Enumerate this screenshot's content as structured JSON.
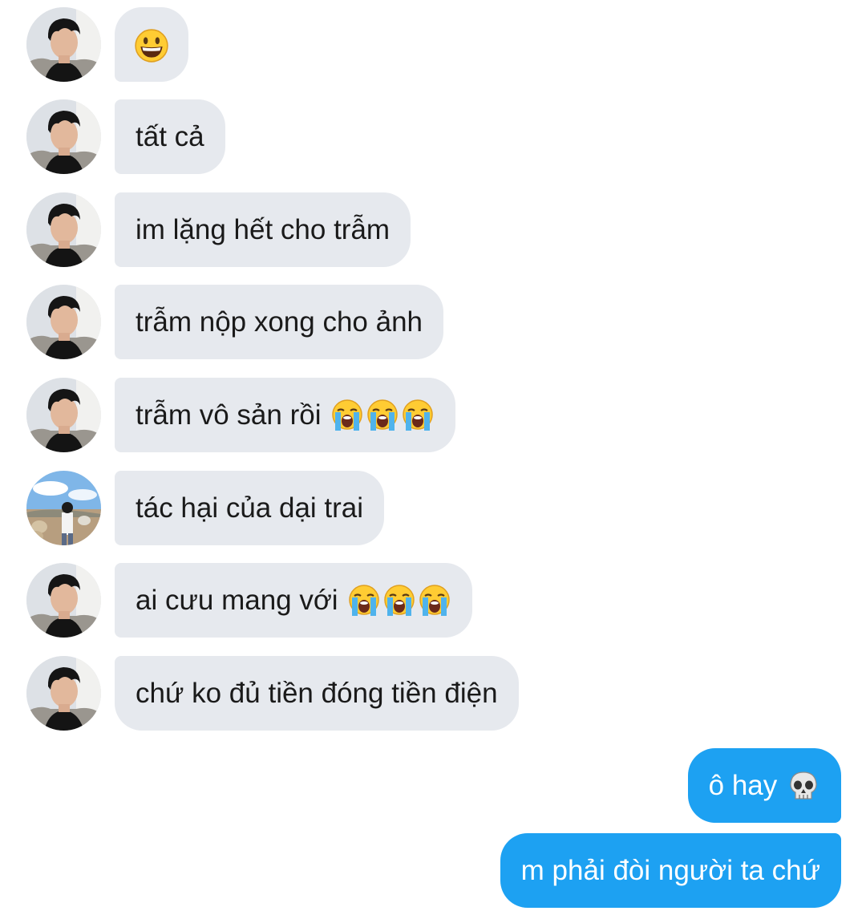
{
  "messages": [
    {
      "text": "",
      "emoji": [
        "grinning-face"
      ]
    },
    {
      "text": "tất cả",
      "emoji": []
    },
    {
      "text": "im lặng hết cho trẫm",
      "emoji": []
    },
    {
      "text": "trẫm nộp xong cho ảnh",
      "emoji": []
    },
    {
      "text": "trẫm vô sản rồi ",
      "emoji": [
        "loudly-crying-face",
        "loudly-crying-face",
        "loudly-crying-face"
      ]
    },
    {
      "text": "tác hại của dại trai",
      "emoji": []
    },
    {
      "text": "ai cưu mang với ",
      "emoji": [
        "loudly-crying-face",
        "loudly-crying-face",
        "loudly-crying-face"
      ]
    },
    {
      "text": "chứ ko đủ tiền đóng tiền điện",
      "emoji": []
    }
  ],
  "outgoing": [
    {
      "text": "ô hay ",
      "emoji": [
        "skull"
      ]
    },
    {
      "text": "m phải đòi người ta chứ",
      "emoji": []
    }
  ],
  "colors": {
    "incoming_bubble": "#e6e9ee",
    "outgoing_bubble": "#1da1f2"
  }
}
